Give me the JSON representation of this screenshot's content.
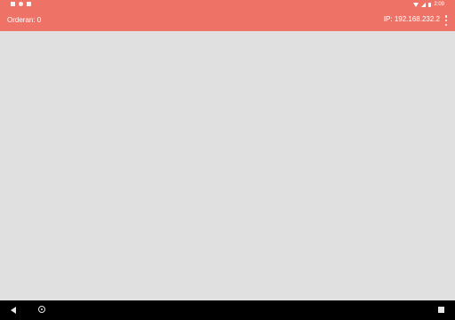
{
  "status_bar": {
    "time": "2:09",
    "icons": [
      "notification-icon",
      "sync-icon",
      "sd-card-icon",
      "wifi-icon",
      "signal-icon",
      "battery-icon"
    ]
  },
  "app_bar": {
    "title": "Orderan: 0",
    "ip": "IP: 192.168.232.2",
    "background": "#ee7366",
    "text_color": "#ffffff"
  },
  "content": {
    "background": "#e0e0e0"
  },
  "nav_bar": {
    "icons": [
      "back-icon",
      "home-icon",
      "recents-icon"
    ]
  }
}
